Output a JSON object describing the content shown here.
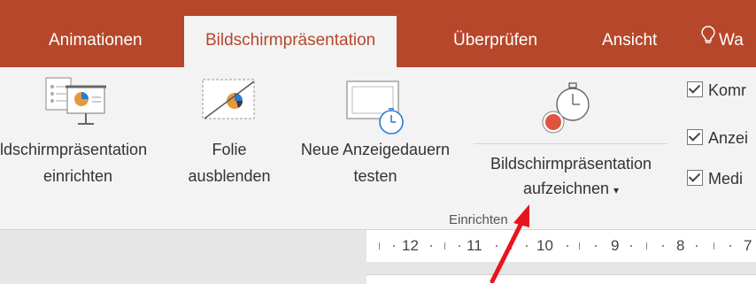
{
  "tabs": [
    {
      "label": "Animationen",
      "active": false
    },
    {
      "label": "Bildschirmpräsentation",
      "active": true
    },
    {
      "label": "Überprüfen",
      "active": false
    },
    {
      "label": "Ansicht",
      "active": false
    },
    {
      "label": "Wa",
      "active": false
    }
  ],
  "ribbon": {
    "setup_line1": "ldschirmpräsentation",
    "setup_line2": "einrichten",
    "hide_line1": "Folie",
    "hide_line2": "ausblenden",
    "rehearse_line1": "Neue Anzeigedauern",
    "rehearse_line2": "testen",
    "record_line1": "Bildschirmpräsentation",
    "record_line2": "aufzeichnen",
    "record_caret": "▾",
    "checkboxes": [
      {
        "label": "Komr",
        "checked": true
      },
      {
        "label": "Anzei",
        "checked": true
      },
      {
        "label": "Medi",
        "checked": true
      }
    ],
    "group_label": "Einrichten"
  },
  "ruler": {
    "labels": [
      "12",
      "11",
      "10",
      "9",
      "8",
      "7"
    ]
  },
  "colors": {
    "accent": "#b7472a",
    "record_red": "#e0533d",
    "arrow_red": "#e8141c"
  }
}
